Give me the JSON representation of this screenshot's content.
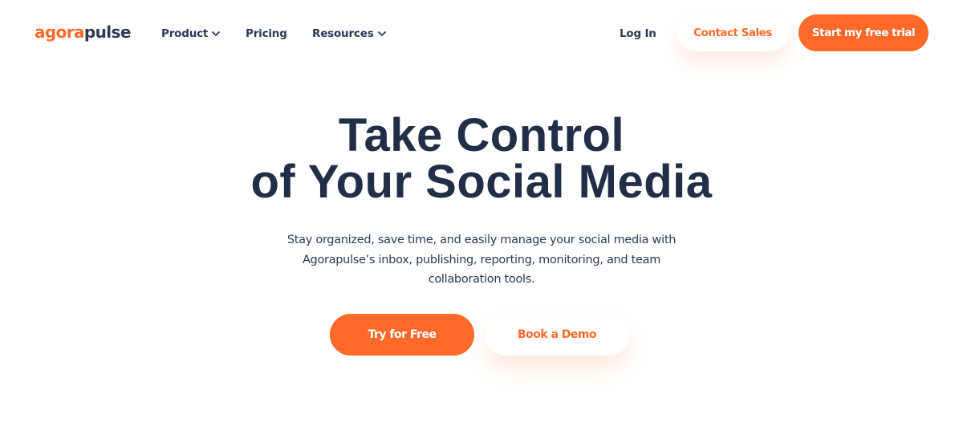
{
  "brand": {
    "logo_part1": "agora",
    "logo_part2": "pulse",
    "accent_color": "#ff6a2b",
    "navy_color": "#212e45"
  },
  "nav": {
    "items": [
      {
        "label": "Product",
        "has_dropdown": true,
        "icon": "chevron-down-icon"
      },
      {
        "label": "Pricing",
        "has_dropdown": false
      },
      {
        "label": "Resources",
        "has_dropdown": true,
        "icon": "chevron-down-icon"
      }
    ],
    "login_label": "Log In",
    "contact_sales_label": "Contact Sales",
    "start_trial_label": "Start my free trial"
  },
  "hero": {
    "title_line1": "Take Control",
    "title_line2": "of Your Social Media",
    "subtitle": "Stay organized, save time, and easily manage your social media with Agorapulse’s inbox, publishing, reporting, monitoring, and team collaboration tools.",
    "primary_cta_label": "Try for Free",
    "secondary_cta_label": "Book a Demo"
  }
}
